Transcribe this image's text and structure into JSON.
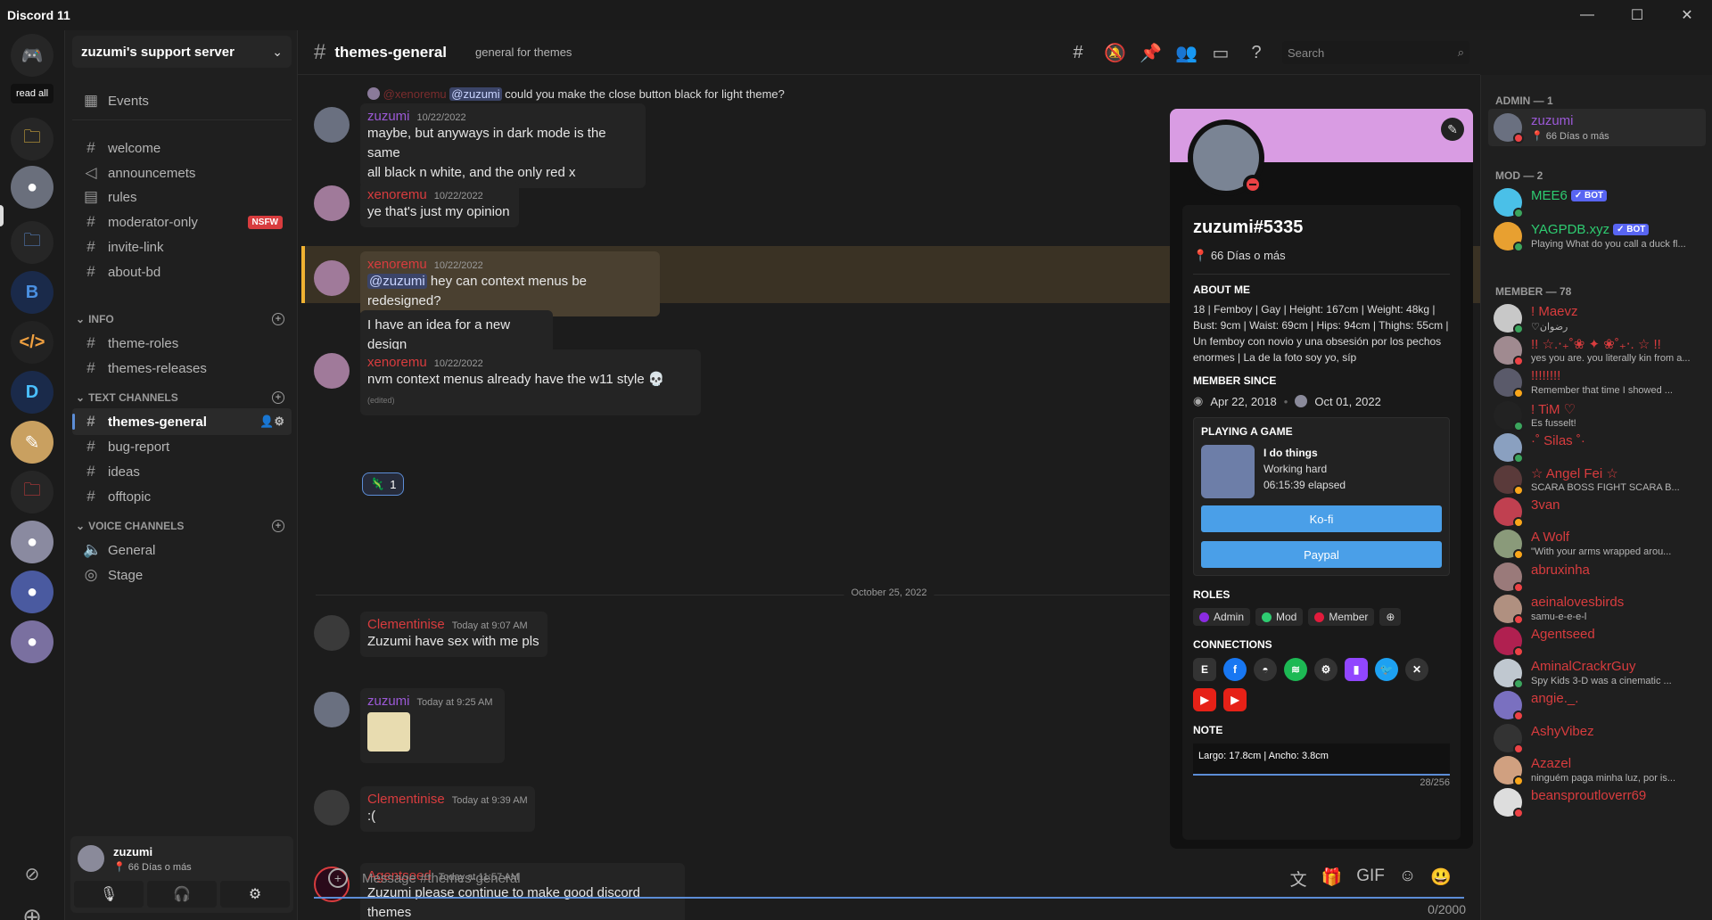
{
  "app": {
    "title": "Discord 11"
  },
  "guilds": {
    "read_all": "read all"
  },
  "server": {
    "name": "zuzumi's support server",
    "events": "Events",
    "channels": [
      {
        "name": "welcome",
        "icon": "#"
      },
      {
        "name": "announcemets",
        "icon": "📢"
      },
      {
        "name": "rules",
        "icon": "📋"
      },
      {
        "name": "moderator-only",
        "icon": "#",
        "badge": "NSFW"
      },
      {
        "name": "invite-link",
        "icon": "#"
      },
      {
        "name": "about-bd",
        "icon": "#"
      }
    ],
    "info_category": "INFO",
    "info_channels": [
      {
        "name": "theme-roles"
      },
      {
        "name": "themes-releases"
      }
    ],
    "text_category": "TEXT CHANNELS",
    "text_channels": [
      {
        "name": "themes-general"
      },
      {
        "name": "bug-report"
      },
      {
        "name": "ideas"
      },
      {
        "name": "offtopic"
      }
    ],
    "voice_category": "VOICE CHANNELS",
    "voice_channels": [
      {
        "name": "General"
      },
      {
        "name": "Stage"
      }
    ]
  },
  "user_panel": {
    "name": "zuzumi",
    "status": "66 Días o más"
  },
  "header": {
    "channel": "themes-general",
    "topic": "general for themes",
    "search_placeholder": "Search"
  },
  "messages": [
    {
      "reply_user": "@xenoremu",
      "reply_mention": "@zuzumi",
      "reply_text": "could you make the close button black for light theme?"
    },
    {
      "user": "zuzumi",
      "time": "10/22/2022",
      "color": "#9b59d6",
      "lines": [
        "maybe, but anyways in dark mode is the same",
        "all black n white, and the only red x"
      ]
    },
    {
      "user": "xenoremu",
      "time": "10/22/2022",
      "color": "#d83c3e",
      "lines": [
        "ye that's just my opinion"
      ]
    },
    {
      "user": "xenoremu",
      "time": "10/22/2022",
      "color": "#d83c3e",
      "mention": "@zuzumi",
      "text": "hey can context menus be redesigned?",
      "extra": "I have an idea for a new design"
    },
    {
      "user": "xenoremu",
      "time": "10/22/2022",
      "color": "#d83c3e",
      "text": "nvm context menus already have the w11 style",
      "edited": "(edited)",
      "reaction": "1"
    },
    {
      "user": "Clementinise",
      "time": "Today at 9:07 AM",
      "color": "#d83c3e",
      "text": "Zuzumi have sex with me pls"
    },
    {
      "user": "zuzumi",
      "time": "Today at 9:25 AM",
      "color": "#9b59d6"
    },
    {
      "user": "Clementinise",
      "time": "Today at 9:39 AM",
      "color": "#d83c3e",
      "text": ":("
    },
    {
      "user": "Agentseed",
      "time": "Today at 11:57 AM",
      "color": "#d83c3e",
      "text": "Zuzumi please continue to make good discord themes"
    }
  ],
  "date_divider": "October 25, 2022",
  "composer": {
    "placeholder": "Message #themes-general",
    "counter": "0/2000"
  },
  "profile": {
    "tag": "zuzumi#5335",
    "status": "66 Días o más",
    "about_label": "ABOUT ME",
    "about": "18 | Femboy | Gay | Height: 167cm | Weight: 48kg | Bust: 9cm | Waist: 69cm | Hips: 94cm | Thighs: 55cm | Un femboy con novio y una obsesión por los pechos enormes | La de la foto soy yo, síp",
    "since_label": "MEMBER SINCE",
    "since_discord": "Apr 22, 2018",
    "since_server": "Oct 01, 2022",
    "game_label": "PLAYING A GAME",
    "game_name": "I do things",
    "game_state": "Working hard",
    "game_elapsed": "06:15:39 elapsed",
    "btn1": "Ko-fi",
    "btn2": "Paypal",
    "roles_label": "ROLES",
    "roles": [
      {
        "name": "Admin",
        "color": "#8b2be2"
      },
      {
        "name": "Mod",
        "color": "#2ecc71"
      },
      {
        "name": "Member",
        "color": "#e21b3c"
      }
    ],
    "connections_label": "CONNECTIONS",
    "note_label": "NOTE",
    "note": "Largo: 17.8cm | Ancho: 3.8cm",
    "note_count": "28/256"
  },
  "members": {
    "admin_label": "ADMIN — 1",
    "mod_label": "MOD — 2",
    "member_label": "MEMBER — 78",
    "bot_label": "✓ BOT",
    "admins": [
      {
        "name": "zuzumi",
        "status": "66 Días o más",
        "color": "#9b59d6"
      }
    ],
    "mods": [
      {
        "name": "MEE6",
        "color": "#2ecc71",
        "bot": true,
        "status": ""
      },
      {
        "name": "YAGPDB.xyz",
        "color": "#2ecc71",
        "bot": true,
        "status": "Playing What do you call a duck fl..."
      }
    ],
    "list": [
      {
        "name": "! Maevz",
        "status": "♡رضوان"
      },
      {
        "name": "!! ☆.‧₊˚❀ ✦ ❀˚₊‧. ☆ !!",
        "status": "yes you are. you literally kin from a..."
      },
      {
        "name": "!!!!!!!!",
        "status": "Remember that time I showed ..."
      },
      {
        "name": "!  TiM ♡",
        "status": "Es fusselt!"
      },
      {
        "name": "·˚ Silas ˚·",
        "status": ""
      },
      {
        "name": "☆ Angel Fei ☆",
        "status": "SCARA BOSS FIGHT SCARA B..."
      },
      {
        "name": "3van",
        "status": ""
      },
      {
        "name": "A Wolf",
        "status": "\"With your arms wrapped arou..."
      },
      {
        "name": "abruxinha",
        "status": ""
      },
      {
        "name": "aeinalovesbirds",
        "status": "samu-e-e-e-l"
      },
      {
        "name": "Agentseed",
        "status": ""
      },
      {
        "name": "AminalCrackrGuy",
        "status": "Spy Kids 3-D was a cinematic ..."
      },
      {
        "name": "angie._.",
        "status": ""
      },
      {
        "name": "AshyVibez",
        "status": ""
      },
      {
        "name": "Azazel",
        "status": "ninguém paga minha luz, por is..."
      },
      {
        "name": "beansproutloverr69",
        "status": ""
      }
    ]
  }
}
